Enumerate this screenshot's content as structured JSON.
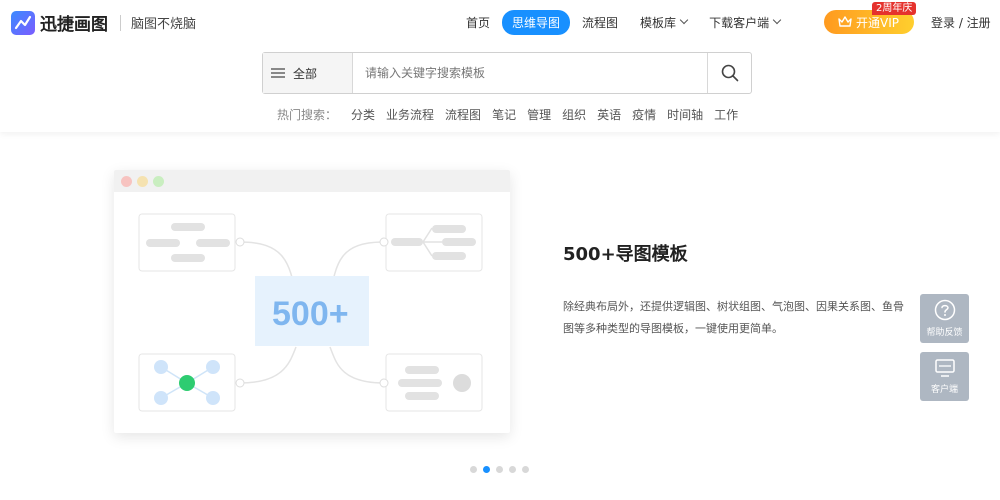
{
  "brand": {
    "name": "迅捷画图",
    "slogan": "脑图不烧脑"
  },
  "nav": {
    "items": [
      {
        "label": "首页"
      },
      {
        "label": "思维导图"
      },
      {
        "label": "流程图"
      },
      {
        "label": "模板库"
      },
      {
        "label": "下载客户端"
      }
    ],
    "vip_label": "开通VIP",
    "vip_badge": "2周年庆",
    "login_label": "登录 / 注册"
  },
  "search": {
    "scope": "全部",
    "placeholder": "请输入关键字搜索模板"
  },
  "hot_search": {
    "label": "热门搜索：",
    "terms": [
      "分类",
      "业务流程",
      "流程图",
      "笔记",
      "管理",
      "组织",
      "英语",
      "疫情",
      "时间轴",
      "工作"
    ]
  },
  "banner": {
    "preview_badge": "500+",
    "title": "500+导图模板",
    "description": "除经典布局外，还提供逻辑图、树状组图、气泡图、因果关系图、鱼骨图等多种类型的导图模板，一键使用更简单。",
    "slide_count": 5,
    "active_slide": 2
  },
  "side_tools": {
    "help_label": "帮助反馈",
    "client_label": "客户端"
  },
  "colors": {
    "primary": "#1890ff",
    "vip_start": "#ff9a1f",
    "vip_end": "#ffcf2e",
    "badge_red": "#e5322d",
    "node_green": "#2ecc71",
    "side_button": "#aeb7c2"
  }
}
